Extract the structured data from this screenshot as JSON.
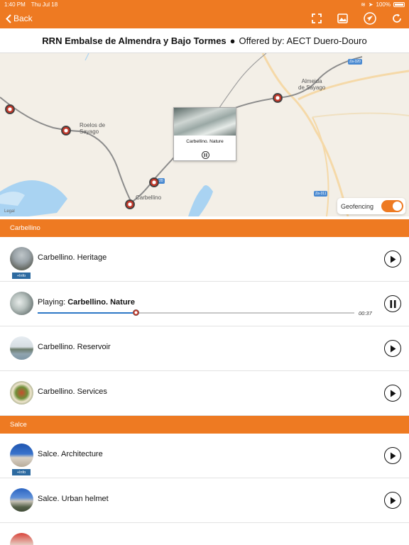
{
  "status": {
    "time": "1:40 PM",
    "date": "Thu Jul 18",
    "battery": "100%"
  },
  "nav": {
    "back_label": "Back"
  },
  "title": {
    "route": "RRN Embalse de Almendra y Bajo Tormes",
    "separator": "●",
    "offered_by": "Offered by: AECT Duero-Douro"
  },
  "map": {
    "labels": {
      "almeida": "Almeida\nde Sayago",
      "roelos": "Roelos de\nSayago",
      "carbellino": "Carbellino"
    },
    "shields": {
      "za320": "Za-320",
      "za311": "Za-311",
      "za_short": "20"
    },
    "legal": "Legal",
    "callout": {
      "title": "Carbellino. Nature"
    },
    "geofencing_label": "Geofencing",
    "geofencing_on": true
  },
  "sections": [
    {
      "name": "Carbellino",
      "items": [
        {
          "title": "Carbellino. Heritage",
          "info": "+Info",
          "state": "play"
        },
        {
          "prefix": "Playing: ",
          "title": "Carbellino. Nature",
          "state": "pause",
          "progress": 0.31,
          "elapsed": "00:37"
        },
        {
          "title": "Carbellino. Reservoir",
          "state": "play"
        },
        {
          "title": "Carbellino. Services",
          "state": "play"
        }
      ]
    },
    {
      "name": "Salce",
      "items": [
        {
          "title": "Salce. Architecture",
          "info": "+Info",
          "state": "play"
        },
        {
          "title": "Salce. Urban helmet",
          "state": "play"
        }
      ]
    }
  ],
  "colors": {
    "accent": "#ee7a22",
    "progress": "#2d78c6",
    "badge": "#2d6aa0"
  }
}
